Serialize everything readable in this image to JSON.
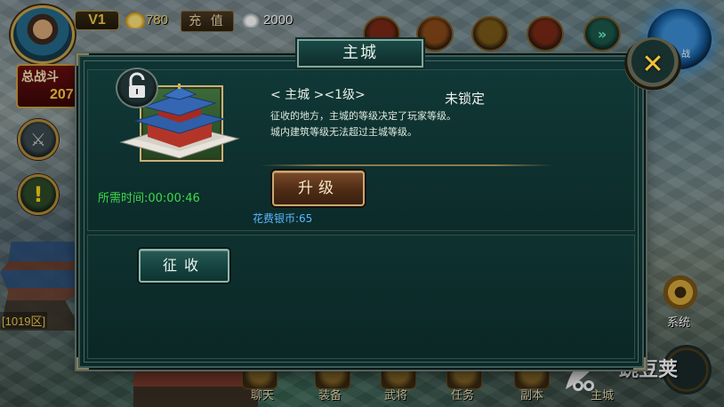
{
  "hud": {
    "vip_level": "V1",
    "gold_amount": "780",
    "recharge_label": "充 值",
    "silver_amount": "2000",
    "power_label": "总战斗",
    "power_value": "207",
    "battle_label": "战"
  },
  "dialog": {
    "title": "主城",
    "close_glyph": "✕",
    "building_name": "< 主城 ><1级>",
    "lock_status": "未锁定",
    "description_lines": [
      "征收的地方，主城的等级决定了玩家等级。",
      "城内建筑等级无法超过主城等级。"
    ],
    "time_required": "所需时间:00:00:46",
    "upgrade_label": "升级",
    "cost_text": "花费银币:65",
    "collect_label": "征收"
  },
  "side": {
    "region_label": "[1019区]",
    "system_label": "系统"
  },
  "bottom_menu": {
    "items": [
      "聊天",
      "装备",
      "武将",
      "任务",
      "副本",
      "主城"
    ]
  },
  "watermark": {
    "text": "豌豆荚"
  },
  "colors": {
    "time_green": "#3fd84a",
    "cost_blue": "#5ab8ff",
    "gold_text": "#f3d36a",
    "close_x": "#f2c23a"
  },
  "icons": {
    "lock": "unlock-icon",
    "close": "close-icon",
    "gold": "gold-ingot-icon",
    "silver": "silver-ingot-icon",
    "system": "gear-icon"
  }
}
